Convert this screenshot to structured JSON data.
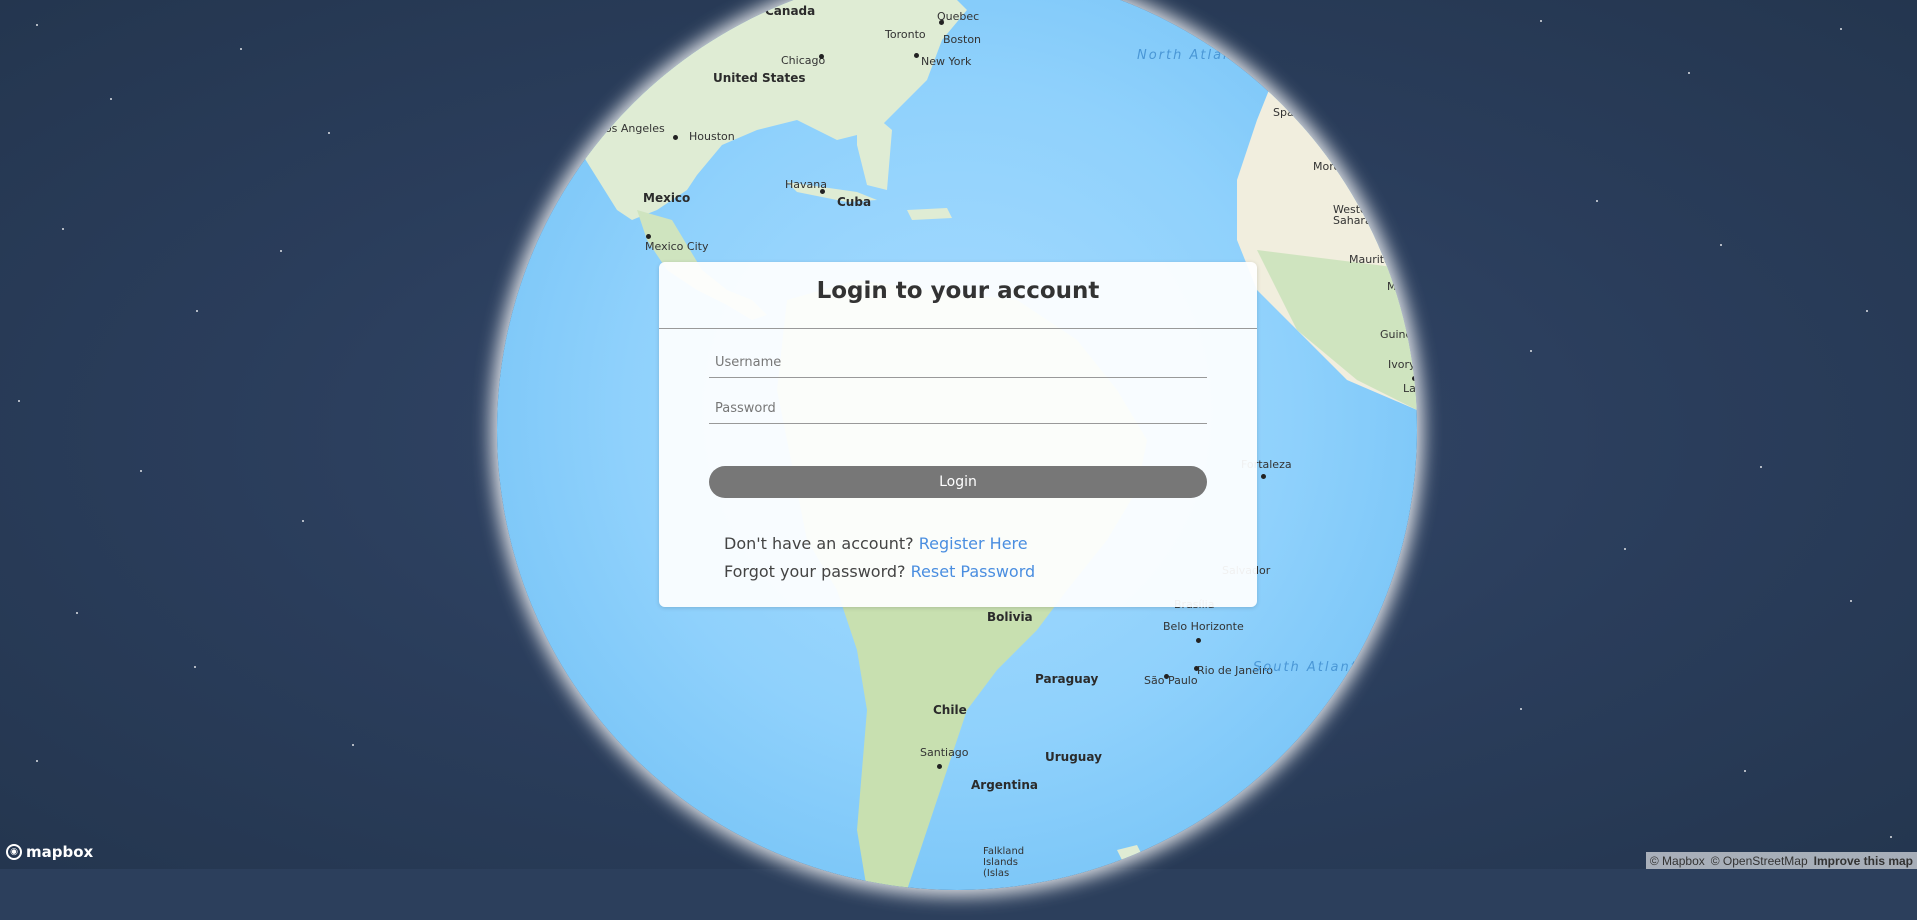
{
  "login": {
    "title": "Login to your account",
    "username_placeholder": "Username",
    "password_placeholder": "Password",
    "login_label": "Login",
    "register_prompt": "Don't have an account?",
    "register_link": "Register Here",
    "reset_prompt": "Forgot your password?",
    "reset_link": "Reset Password"
  },
  "map": {
    "labels": {
      "canada": "Canada",
      "quebec": "Quebec",
      "toronto": "Toronto",
      "boston": "Boston",
      "chicago": "Chicago",
      "new_york": "New York",
      "united_states": "United States",
      "los_angeles": "Los Angeles",
      "houston": "Houston",
      "mexico": "Mexico",
      "havana": "Havana",
      "cuba": "Cuba",
      "mexico_city": "Mexico City",
      "north_atlantic": "North Atlantic Ocean",
      "spain": "Spain",
      "morocco": "Morocco",
      "western_sahara": "Western Sahara",
      "mauritania": "Mauritania",
      "mali": "Mali",
      "guinea": "Guinea",
      "ivory_coast": "Ivory Coast",
      "lagos": "Lagos",
      "fortaleza": "Fortaleza",
      "salvador": "Salvador",
      "brasilia": "Brasília",
      "belo_horizonte": "Belo Horizonte",
      "rio": "Rio de Janeiro",
      "sao_paulo": "São Paulo",
      "south_atlantic": "South Atlantic Ocean",
      "bolivia": "Bolivia",
      "paraguay": "Paraguay",
      "chile": "Chile",
      "santiago": "Santiago",
      "uruguay": "Uruguay",
      "argentina": "Argentina",
      "falkland": "Falkland Islands (Islas"
    }
  },
  "footer": {
    "logo": "mapbox",
    "attribution_mapbox": "© Mapbox",
    "attribution_osm": "© OpenStreetMap",
    "improve": "Improve this map"
  }
}
